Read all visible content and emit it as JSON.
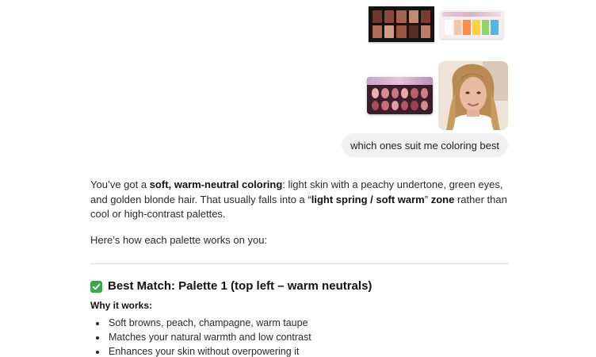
{
  "user_message": {
    "images": [
      {
        "name": "palette-warm-neutrals",
        "swatches": [
          "#6b3a2c",
          "#8b4a3a",
          "#a26450",
          "#c28a72",
          "#7a3b35",
          "#b06a5a",
          "#d29a84",
          "#9a5440",
          "#5a2e26",
          "#c07a66"
        ]
      },
      {
        "name": "palette-bright-pastel",
        "swatches": [
          "#ffffff",
          "#f3c7a4",
          "#ff8c4b",
          "#ffd23d",
          "#8fd46c",
          "#4fb8e8"
        ]
      },
      {
        "name": "palette-rose-pink",
        "swatches": [
          "#e8b1b4",
          "#d68c95",
          "#c77683",
          "#e9a6a8",
          "#b85c6e",
          "#d27c88",
          "#a84b5e",
          "#c96a7a",
          "#e19ba5",
          "#b35468",
          "#9c3f55",
          "#d48a96"
        ]
      },
      {
        "name": "user-selfie-photo"
      }
    ],
    "text": "which ones suit me coloring best"
  },
  "assistant": {
    "intro": {
      "t1": "You’ve got a ",
      "b1": "soft, warm-neutral coloring",
      "t2": ": light skin with a peachy undertone, green eyes, and golden blonde hair. That usually falls into a “",
      "b2": "light spring / soft warm",
      "t3": "” ",
      "b3": "zone",
      "t4": " rather than cool or high-contrast palettes."
    },
    "lead": "Here’s how each palette works on you:",
    "best_match": {
      "heading": "Best Match: Palette 1 (top left – warm neutrals)",
      "why_label": "Why it works:",
      "bullets": [
        "Soft browns, peach, champagne, warm taupe",
        "Matches your natural warmth and low contrast",
        "Enhances your skin without overpowering it"
      ]
    }
  },
  "colors": {
    "bubble_bg": "#f1f1f1",
    "check_green": "#3aa74a",
    "divider": "#dedede"
  }
}
